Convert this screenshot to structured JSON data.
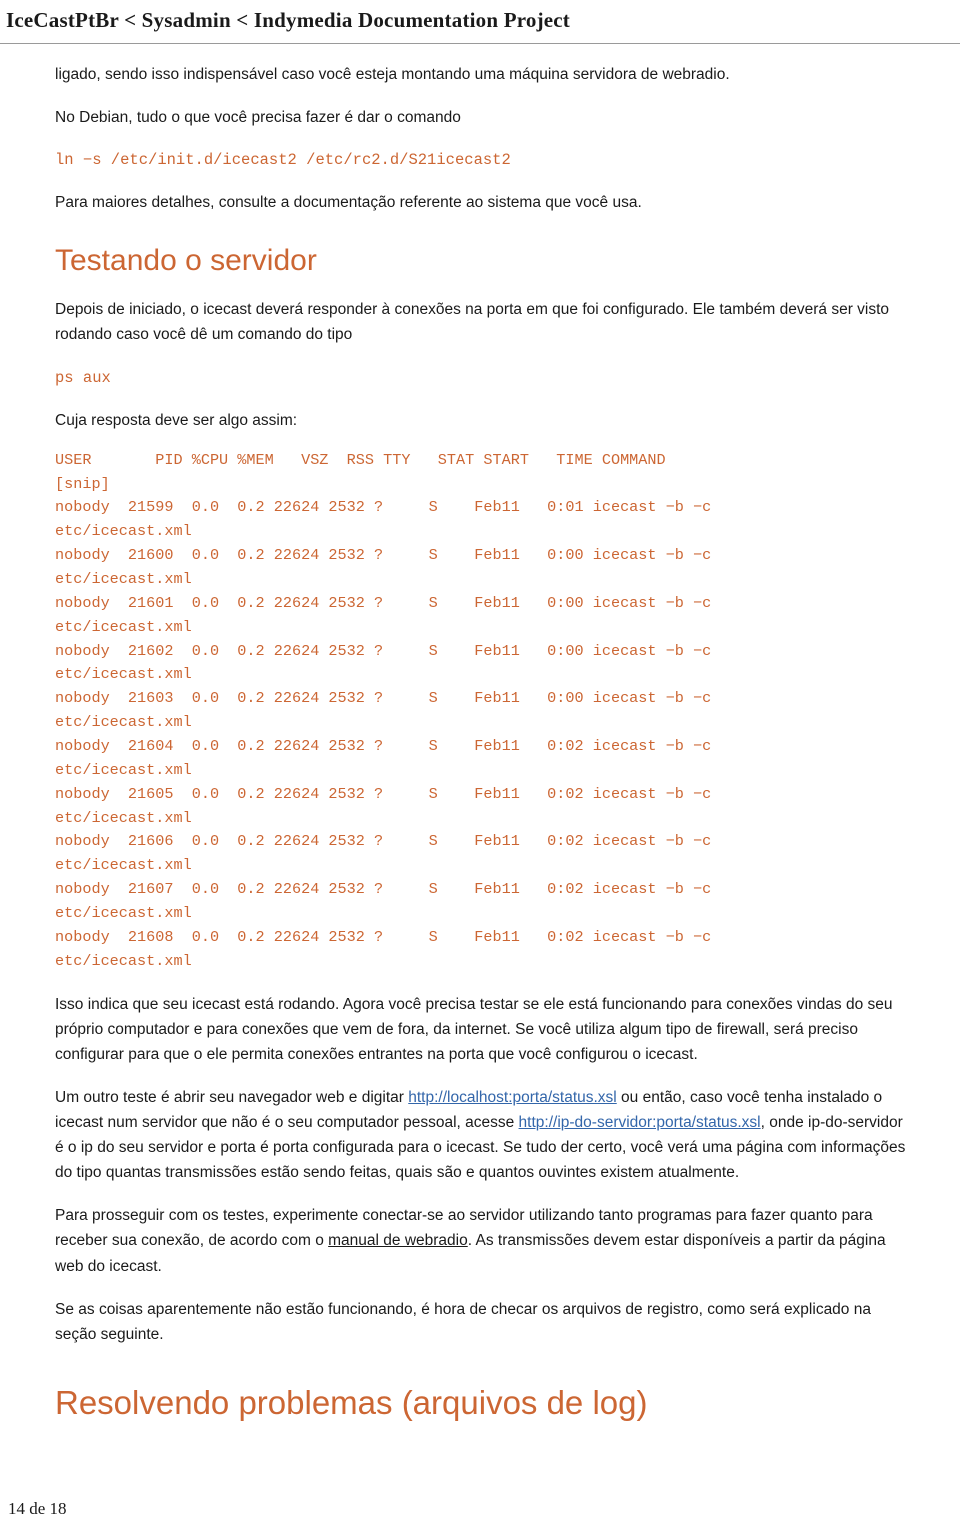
{
  "header": {
    "title": "IceCastPtBr < Sysadmin < Indymedia Documentation Project"
  },
  "body": {
    "para1": "ligado, sendo isso indispensável caso você esteja montando uma máquina servidora de webradio.",
    "para2": "No Debian, tudo o que você precisa fazer é dar o comando",
    "code1": "ln −s /etc/init.d/icecast2 /etc/rc2.d/S21icecast2",
    "para3": "Para maiores detalhes, consulte a documentação referente ao sistema que você usa.",
    "heading1": "Testando o servidor",
    "para4": "Depois de iniciado, o icecast deverá responder à conexões na porta em que foi configurado. Ele também deverá ser visto rodando caso você dê um comando do tipo",
    "code2": "ps aux",
    "para5": "Cuja resposta deve ser algo assim:",
    "listing": "USER       PID %CPU %MEM   VSZ  RSS TTY   STAT START   TIME COMMAND\n[snip]\nnobody  21599  0.0  0.2 22624 2532 ?     S    Feb11   0:01 icecast −b −c\netc/icecast.xml\nnobody  21600  0.0  0.2 22624 2532 ?     S    Feb11   0:00 icecast −b −c\netc/icecast.xml\nnobody  21601  0.0  0.2 22624 2532 ?     S    Feb11   0:00 icecast −b −c\netc/icecast.xml\nnobody  21602  0.0  0.2 22624 2532 ?     S    Feb11   0:00 icecast −b −c\netc/icecast.xml\nnobody  21603  0.0  0.2 22624 2532 ?     S    Feb11   0:00 icecast −b −c\netc/icecast.xml\nnobody  21604  0.0  0.2 22624 2532 ?     S    Feb11   0:02 icecast −b −c\netc/icecast.xml\nnobody  21605  0.0  0.2 22624 2532 ?     S    Feb11   0:02 icecast −b −c\netc/icecast.xml\nnobody  21606  0.0  0.2 22624 2532 ?     S    Feb11   0:02 icecast −b −c\netc/icecast.xml\nnobody  21607  0.0  0.2 22624 2532 ?     S    Feb11   0:02 icecast −b −c\netc/icecast.xml\nnobody  21608  0.0  0.2 22624 2532 ?     S    Feb11   0:02 icecast −b −c\netc/icecast.xml",
    "para6": "Isso indica que seu icecast está rodando. Agora você precisa testar se ele está funcionando para conexões vindas do seu próprio computador e para conexões que vem de fora, da internet. Se você utiliza algum tipo de firewall, será preciso configurar para que o ele permita conexões entrantes na porta que você configurou o icecast.",
    "para7_a": "Um outro teste é abrir seu navegador web e digitar ",
    "para7_link1": "http://localhost:porta/status.xsl",
    "para7_b": " ou então, caso você tenha instalado o icecast num servidor que não é o seu computador pessoal, acesse ",
    "para7_link2": "http://ip-do-servidor:porta/status.xsl",
    "para7_c": ", onde ip-do-servidor é o ip do seu servidor e porta é porta configurada para o icecast. Se tudo der certo, você verá uma página com informações do tipo quantas transmissões estão sendo feitas, quais são e quantos ouvintes existem atualmente.",
    "para8_a": "Para prosseguir com os testes, experimente conectar-se ao servidor utilizando tanto programas para fazer quanto para receber sua conexão, de acordo com o ",
    "para8_link": "manual de webradio",
    "para8_b": ". As transmissões devem estar disponíveis a partir da página web do icecast.",
    "para9": "Se as coisas aparentemente não estão funcionando, é hora de checar os arquivos de registro, como será explicado na seção seguinte.",
    "heading2": "Resolvendo problemas (arquivos de log)"
  },
  "footer": {
    "page_label": "14 de 18"
  }
}
